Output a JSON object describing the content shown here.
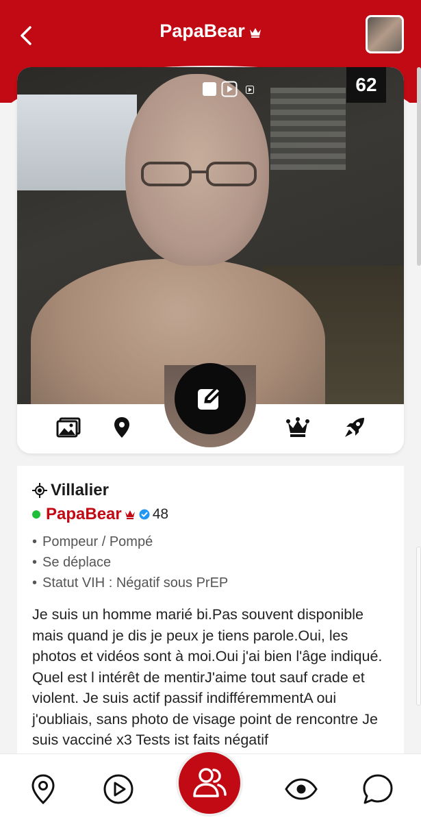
{
  "header": {
    "title": "PapaBear",
    "crown_icon": "crown-icon",
    "back_icon": "chevron-left-icon"
  },
  "photo": {
    "counter": "62"
  },
  "profile": {
    "city": "Villalier",
    "username": "PapaBear",
    "age": "48",
    "online": true,
    "tags": [
      "Pompeur / Pompé",
      "Se déplace",
      "Statut VIH : Négatif sous PrEP"
    ],
    "description": "Je suis un homme marié bi.Pas souvent disponible mais quand je dis je peux je tiens parole.Oui, les photos et vidéos sont à moi.Oui j'ai bien l'âge indiqué. Quel est l intérêt de mentirJ'aime tout sauf crade et violent. Je suis actif passif indifféremmentA oui j'oubliais, sans photo de visage point de rencontre Je suis vacciné x3 Tests ist faits négatif"
  },
  "colors": {
    "brand_red": "#c20a14",
    "online_green": "#1fbf3a",
    "verified_blue": "#2196f3"
  }
}
